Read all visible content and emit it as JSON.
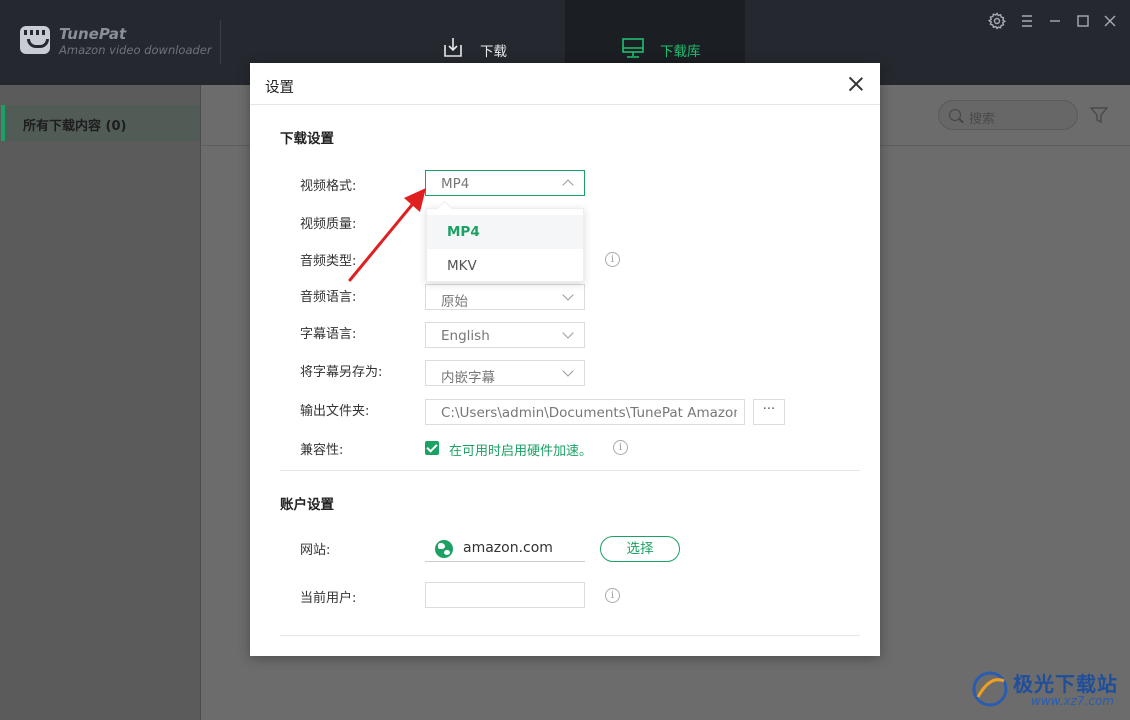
{
  "app": {
    "name": "TunePat",
    "subtitle": "Amazon video downloader"
  },
  "tabs": [
    {
      "label": "下载",
      "icon": "download-icon",
      "active": false
    },
    {
      "label": "下载库",
      "icon": "library-icon",
      "active": true
    }
  ],
  "window_controls": [
    "gear-icon",
    "menu-icon",
    "minimize-icon",
    "maximize-icon",
    "close-icon"
  ],
  "sidebar": {
    "items": [
      {
        "label": "所有下载内容 (0)",
        "active": true
      }
    ]
  },
  "search": {
    "placeholder": "搜索"
  },
  "dialog": {
    "title": "设置",
    "download_section": {
      "title": "下载设置",
      "video_format": {
        "label": "视频格式:",
        "value": "MP4",
        "options": [
          "MP4",
          "MKV"
        ]
      },
      "video_quality": {
        "label": "视频质量:"
      },
      "audio_type": {
        "label": "音频类型:"
      },
      "audio_language": {
        "label": "音频语言:",
        "value": "原始"
      },
      "subtitle_language": {
        "label": "字幕语言:",
        "value": "English"
      },
      "save_subtitle_as": {
        "label": "将字幕另存为:",
        "value": "内嵌字幕"
      },
      "output_folder": {
        "label": "输出文件夹:",
        "value": "C:\\Users\\admin\\Documents\\TunePat Amazon Video Downloader",
        "browse": "···"
      },
      "compatibility": {
        "label": "兼容性:",
        "checkbox_label": "在可用时启用硬件加速。",
        "checked": true
      }
    },
    "account_section": {
      "title": "账户设置",
      "website": {
        "label": "网站:",
        "value": "amazon.com",
        "button": "选择"
      },
      "current_user": {
        "label": "当前用户:",
        "value": ""
      }
    }
  },
  "watermark": {
    "title": "极光下载站",
    "url": "www.xz7.com"
  },
  "colors": {
    "accent": "#1aa163",
    "titlebar": "#25292f",
    "annotation_arrow": "#e02020"
  }
}
